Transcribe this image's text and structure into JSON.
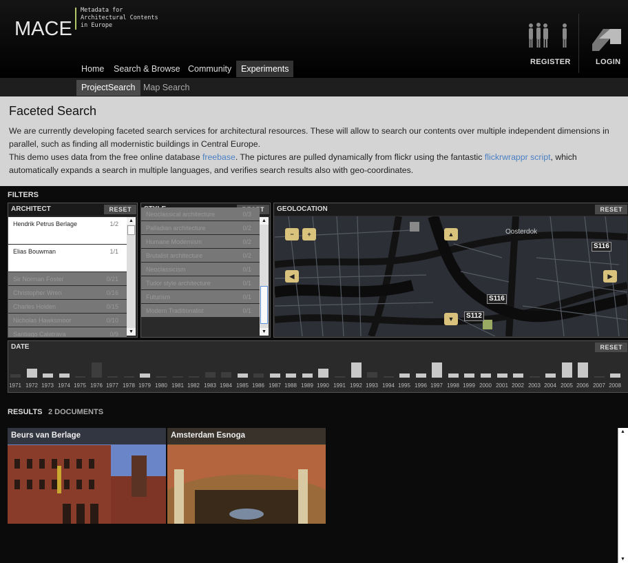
{
  "header": {
    "logo": "MACE",
    "tagline": "Metadata for\nArchitectural Contents\nin Europe",
    "register": "REGISTER",
    "login": "LOGIN"
  },
  "nav": {
    "items": [
      "Home",
      "Search & Browse",
      "Community",
      "Experiments"
    ],
    "active": "Experiments",
    "sub_items": [
      "ProjectSearch",
      "Map Search"
    ],
    "sub_active": "ProjectSearch"
  },
  "intro": {
    "title": "Faceted Search",
    "p1": "We are currently developing faceted search services for architectural resources. These will allow to search our contents over multiple independent dimensions in parallel, such as finding all modernistic buildings in Central Europe.",
    "p2a": "This demo uses data from the free online database ",
    "p2_link1": "freebase",
    "p2b": ". The pictures are pulled dynamically from flickr using the fantastic ",
    "p2_link2": "flickrwrappr script",
    "p2c": ", which automatically expands a search in multiple languages, and verifies search results also with geo-coordinates."
  },
  "filters": {
    "label": "FILTERS",
    "reset": "RESET",
    "architect": {
      "title": "ARCHITECT",
      "items": [
        {
          "name": "Hendrik Petrus Berlage",
          "count": "1/2",
          "selected": true
        },
        {
          "name": "Elias Bouwman",
          "count": "1/1",
          "selected": true
        },
        {
          "name": "Sir Norman Foster",
          "count": "0/21",
          "selected": false
        },
        {
          "name": "Christopher Wren",
          "count": "0/16",
          "selected": false
        },
        {
          "name": "Charles Holden",
          "count": "0/15",
          "selected": false
        },
        {
          "name": "Nicholas Hawksmoor",
          "count": "0/10",
          "selected": false
        },
        {
          "name": "Santiago Calatrava",
          "count": "0/9",
          "selected": false
        }
      ]
    },
    "style": {
      "title": "STYLE",
      "items": [
        {
          "name": "Neoclassical architecture",
          "count": "0/3"
        },
        {
          "name": "Palladian architecture",
          "count": "0/2"
        },
        {
          "name": "Humane Modernism",
          "count": "0/2"
        },
        {
          "name": "Brutalist architecture",
          "count": "0/2"
        },
        {
          "name": "Neoclassicism",
          "count": "0/1"
        },
        {
          "name": "Tudor style architecture",
          "count": "0/1"
        },
        {
          "name": "Futurism",
          "count": "0/1"
        },
        {
          "name": "Modern Traditionalist",
          "count": "0/1"
        }
      ]
    },
    "geolocation": {
      "title": "GEOLOCATION",
      "labels": [
        "Oosterdok",
        "S116",
        "S116",
        "S112"
      ]
    },
    "date": {
      "title": "DATE",
      "years": [
        "1971",
        "1972",
        "1973",
        "1974",
        "1975",
        "1976",
        "1977",
        "1978",
        "1979",
        "1980",
        "1981",
        "1982",
        "1983",
        "1984",
        "1985",
        "1986",
        "1987",
        "1988",
        "1989",
        "1990",
        "1991",
        "1992",
        "1993",
        "1994",
        "1995",
        "1996",
        "1997",
        "1998",
        "1999",
        "2000",
        "2001",
        "2002",
        "2003",
        "2004",
        "2005",
        "2006",
        "2007",
        "2008"
      ],
      "highlighted": [
        0,
        1,
        1,
        1,
        0,
        0,
        0,
        0,
        1,
        0,
        0,
        0,
        0,
        0,
        1,
        0,
        1,
        1,
        1,
        1,
        0,
        1,
        0,
        0,
        1,
        1,
        1,
        1,
        1,
        1,
        1,
        1,
        0,
        1,
        1,
        1,
        0,
        1
      ],
      "levels": [
        0.2,
        0.55,
        0.25,
        0.25,
        0.1,
        0.9,
        0.1,
        0.1,
        0.25,
        0.1,
        0.1,
        0.1,
        0.35,
        0.35,
        0.25,
        0.25,
        0.25,
        0.25,
        0.25,
        0.55,
        0.1,
        0.9,
        0.35,
        0.1,
        0.25,
        0.25,
        0.9,
        0.25,
        0.25,
        0.25,
        0.25,
        0.25,
        0.1,
        0.25,
        0.9,
        0.9,
        0.1,
        0.25
      ]
    }
  },
  "results": {
    "label": "RESULTS",
    "count": "2 DOCUMENTS",
    "items": [
      {
        "title": "Beurs van Berlage"
      },
      {
        "title": "Amsterdam Esnoga"
      }
    ]
  }
}
